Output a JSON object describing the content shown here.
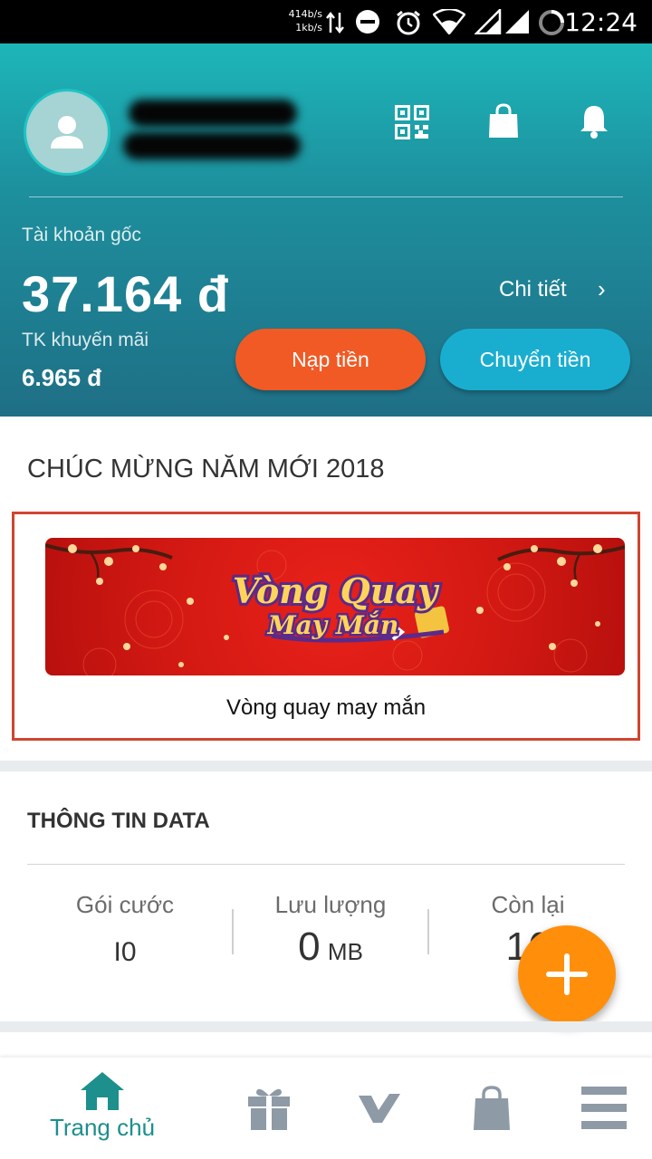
{
  "status_bar": {
    "net_down": "414b/s",
    "net_up": "1kb/s",
    "time": "12:24"
  },
  "header": {
    "icons": [
      "qr-code-icon",
      "shopping-bag-icon",
      "bell-icon"
    ]
  },
  "account": {
    "main_label": "Tài khoản gốc",
    "main_amount": "37.164 đ",
    "detail_label": "Chi tiết",
    "detail_chevron": "›",
    "promo_label": "TK khuyến mãi",
    "promo_amount": "6.965 đ",
    "topup_label": "Nạp tiền",
    "transfer_label": "Chuyển tiền"
  },
  "promo_section": {
    "title": "CHÚC MỪNG NĂM MỚI 2018",
    "banner_caption": "Vòng quay may mắn"
  },
  "data_info": {
    "title": "THÔNG TIN DATA",
    "package_header": "Gói cước",
    "package_value": "I0",
    "usage_header": "Lưu lượng",
    "usage_value": "0",
    "usage_unit": "MB",
    "remaining_header": "Còn lại",
    "remaining_value": "16"
  },
  "fab": {
    "icon": "plus-icon"
  },
  "bottom_nav": {
    "home_label": "Trang chủ",
    "items": [
      "home-icon",
      "gift-icon",
      "brand-v-icon",
      "shopping-bag-icon",
      "menu-icon"
    ]
  },
  "colors": {
    "header_gradient_top": "#1db6b9",
    "header_gradient_bottom": "#1f6f86",
    "topup_button": "#f15a24",
    "transfer_button": "#19aed0",
    "fab": "#ff8f0a",
    "nav_active": "#1d8f8d",
    "promo_border": "#d0452e"
  }
}
